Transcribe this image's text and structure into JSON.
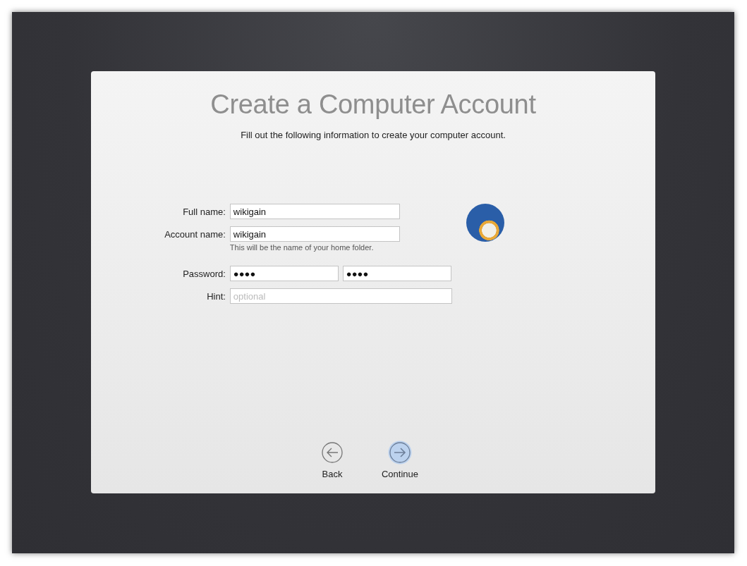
{
  "title": "Create a Computer Account",
  "subtitle": "Fill out the following information to create your computer account.",
  "form": {
    "full_name": {
      "label": "Full name:",
      "value": "wikigain"
    },
    "account_name": {
      "label": "Account name:",
      "value": "wikigain",
      "note": "This will be the name of your home folder."
    },
    "password": {
      "label": "Password:",
      "value": "●●●●",
      "verify_value": "●●●●"
    },
    "hint": {
      "label": "Hint:",
      "placeholder": "optional"
    }
  },
  "nav_buttons": [
    {
      "label": "Back",
      "kind": "back",
      "selected": false
    },
    {
      "label": "Continue",
      "kind": "continue",
      "selected": true
    }
  ]
}
